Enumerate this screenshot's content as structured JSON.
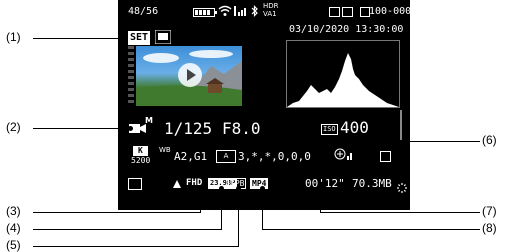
{
  "callouts": [
    "(1)",
    "(2)",
    "(3)",
    "(4)",
    "(5)",
    "(6)",
    "(7)",
    "(8)"
  ],
  "status": {
    "frame_counter": "48/56",
    "hdr_top": "HDR",
    "hdr_bottom": "VA1",
    "folder_file": "100-0003",
    "datetime": "03/10/2020 13:30:00"
  },
  "badges": {
    "set": "SET",
    "movie_mode": "M",
    "wb_badge_top": "K",
    "wb_badge_kelvin": "5200",
    "wb_label": "WB",
    "frame_rate": "23.98P",
    "compression": "IPB",
    "format": "MP4",
    "resolution": "FHD",
    "iso_label": "ISO"
  },
  "exposure": {
    "shutter": "1/125",
    "aperture": "F8.0",
    "iso": "400"
  },
  "settings": {
    "wb_shift": "A2,G1",
    "picture_style": "3,*,*,0,0,0",
    "playtime": "00'12\"",
    "filesize": "70.3MB"
  },
  "colors": {
    "screen_bg": "#000000",
    "histogram": "#ffffff",
    "sky": "#3d8fd8",
    "grass": "#3f7a2e"
  }
}
